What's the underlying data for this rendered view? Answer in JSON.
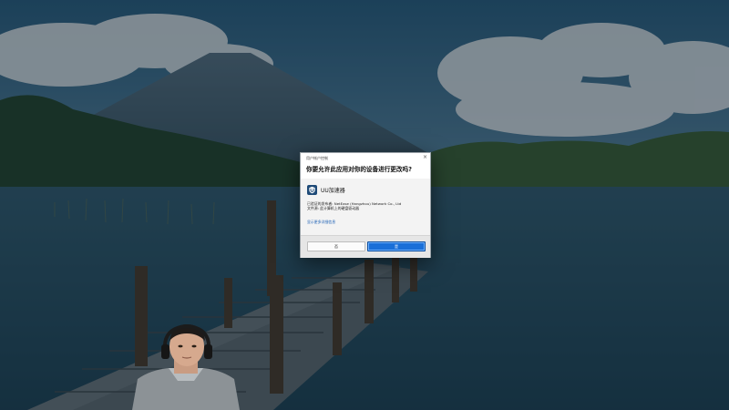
{
  "desktop": {
    "wallpaper_description_icon": "lake-volcano-pier-wallpaper"
  },
  "uac": {
    "caption": "用户帐户控制",
    "close_glyph": "×",
    "question": "你要允许此应用对你的设备进行更改吗?",
    "app_name": "UU加速器",
    "publisher": "已验证的发布者: NetEase (Hangzhou) Network Co., Ltd",
    "origin": "文件源: 此计算机上的硬盘驱动器",
    "details_link": "显示更多详细信息",
    "no_button": "否",
    "yes_button": "是"
  },
  "colors": {
    "accent": "#1a6fd8",
    "link": "#1a5fb4"
  }
}
